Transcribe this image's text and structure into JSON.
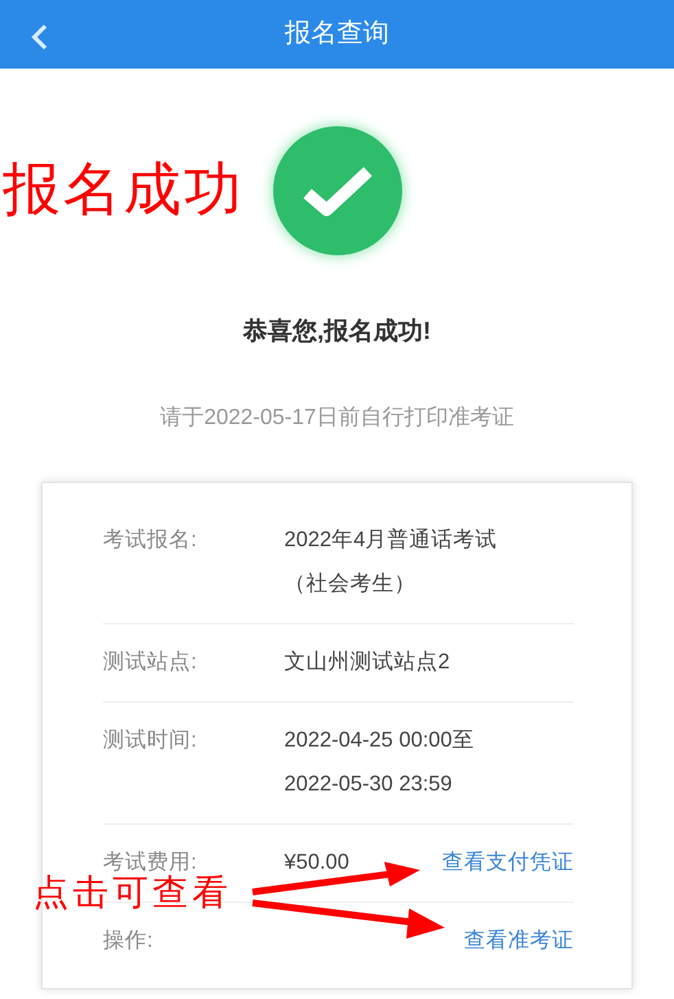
{
  "header": {
    "title": "报名查询"
  },
  "result": {
    "title": "恭喜您,报名成功!",
    "note": "请于2022-05-17日前自行打印准考证"
  },
  "details": [
    {
      "label": "考试报名:",
      "value": [
        "2022年4月普通话考试",
        "（社会考生）"
      ]
    },
    {
      "label": "测试站点:",
      "value": [
        "文山州测试站点2"
      ]
    },
    {
      "label": "测试时间:",
      "value": [
        "2022-04-25 00:00至",
        "2022-05-30 23:59"
      ]
    },
    {
      "label": "考试费用:",
      "value": [
        "¥50.00"
      ],
      "link": "查看支付凭证"
    },
    {
      "label": "操作:",
      "link": "查看准考证"
    }
  ],
  "annotations": {
    "success_label": "报名成功",
    "hint": "点击可查看"
  }
}
